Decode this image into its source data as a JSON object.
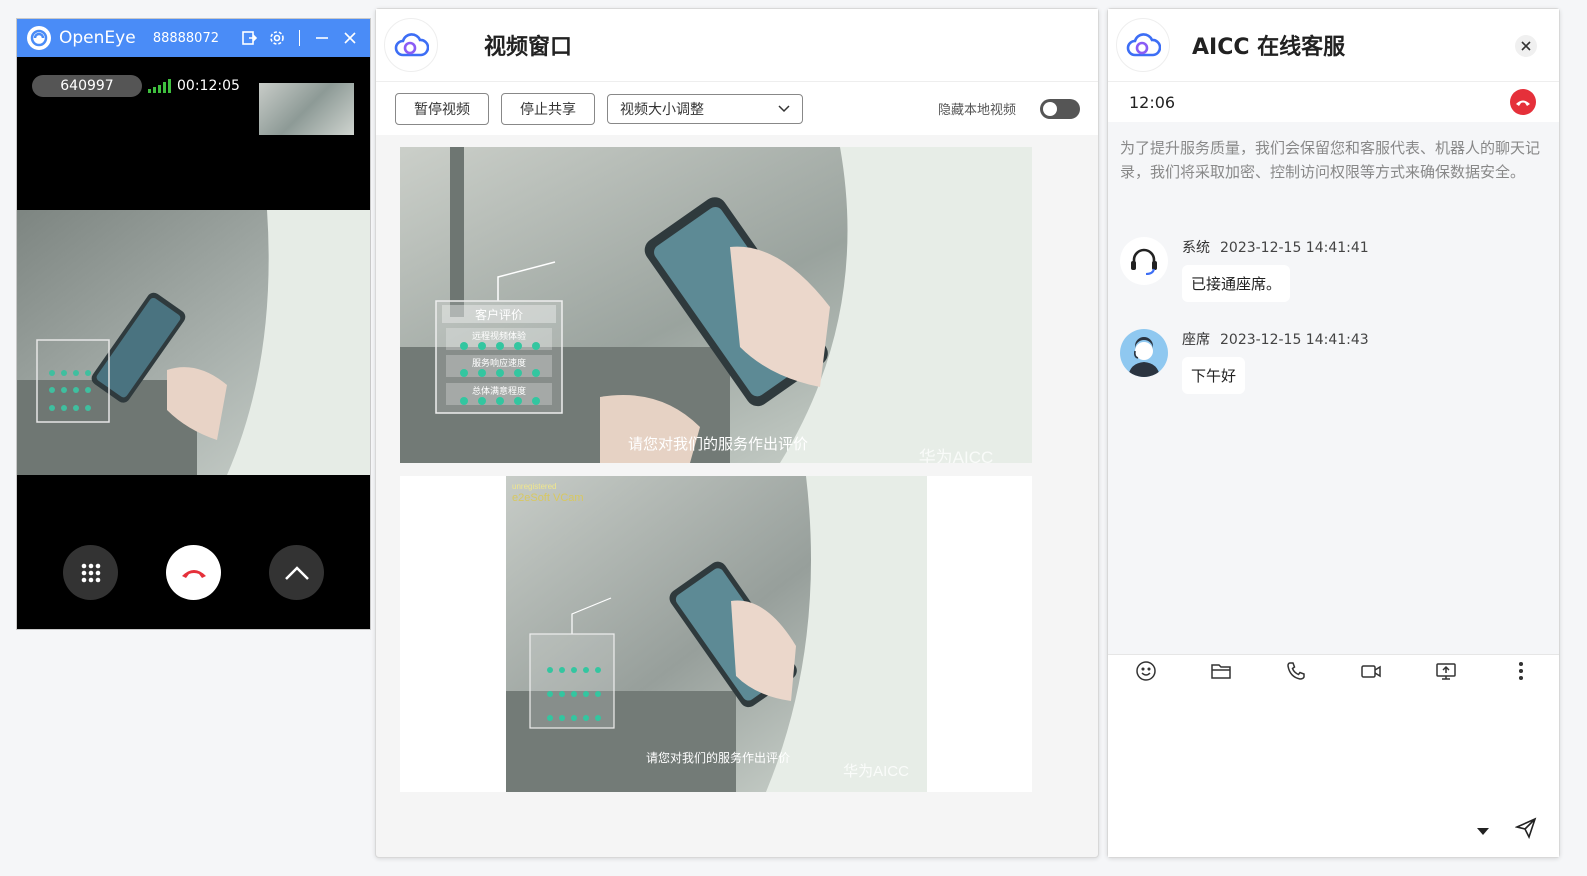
{
  "openeye": {
    "app_name": "OpenEye",
    "account": "88888072",
    "caller_id": "640997",
    "call_duration": "00:12:05",
    "signal_bars": 5
  },
  "video_window": {
    "title": "视频窗口",
    "pause_video": "暂停视频",
    "stop_share": "停止共享",
    "size_select": "视频大小调整",
    "hide_local_label": "隐藏本地视频",
    "hide_local_on": false,
    "video_main": {
      "card_title": "客户评价",
      "items": [
        "远程视频体验",
        "服务响应速度",
        "总体满意程度"
      ],
      "subtitle": "请您对我们的服务作出评价",
      "watermark": "华为AICC"
    },
    "video_local": {
      "overlay_line1": "unregistered",
      "overlay_line2": "e2eSoft VCam"
    }
  },
  "chat": {
    "title": "AICC 在线客服",
    "timer": "12:06",
    "notice": "为了提升服务质量，我们会保留您和客服代表、机器人的聊天记录，我们将采取加密、控制访问权限等方式来确保数据安全。",
    "messages": [
      {
        "sender": "系统",
        "time": "2023-12-15 14:41:41",
        "text": "已接通座席。",
        "avatar_icon": "headset-icon"
      },
      {
        "sender": "座席",
        "time": "2023-12-15 14:41:43",
        "text": "下午好",
        "avatar_icon": "agent-avatar-icon"
      }
    ],
    "toolbar": [
      "emoji-icon",
      "folder-icon",
      "phone-icon",
      "video-camera-icon",
      "screen-share-icon",
      "more-icon"
    ]
  },
  "colors": {
    "openeye_title": "#4a8cf7",
    "hangup_red": "#e5303a",
    "signal_green": "#3fbf3f"
  }
}
